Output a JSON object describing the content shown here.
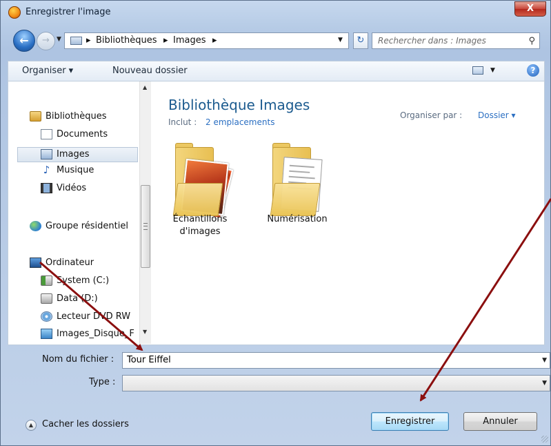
{
  "window": {
    "title": "Enregistrer l'image",
    "close_label": "X"
  },
  "navigation": {
    "breadcrumbs": [
      "Bibliothèques",
      "Images"
    ],
    "search_placeholder": "Rechercher dans : Images"
  },
  "toolbar": {
    "organize_label": "Organiser ▾",
    "new_folder_label": "Nouveau dossier",
    "help_label": "?"
  },
  "nav_pane": {
    "items": [
      {
        "label": "Bibliothèques",
        "icon": "library-icon"
      },
      {
        "label": "Documents",
        "icon": "documents-icon"
      },
      {
        "label": "Images",
        "icon": "pictures-icon",
        "selected": true
      },
      {
        "label": "Musique",
        "icon": "music-icon"
      },
      {
        "label": "Vidéos",
        "icon": "videos-icon"
      },
      {
        "label": "Groupe résidentiel",
        "icon": "homegroup-icon"
      },
      {
        "label": "Ordinateur",
        "icon": "computer-icon"
      },
      {
        "label": "System (C:)",
        "icon": "system-drive-icon"
      },
      {
        "label": "Data (D:)",
        "icon": "drive-icon"
      },
      {
        "label": "Lecteur DVD RW",
        "icon": "dvd-icon"
      },
      {
        "label": "Images_Disque_F",
        "icon": "network-drive-icon"
      }
    ]
  },
  "library": {
    "title": "Bibliothèque Images",
    "includes_label": "Inclut :",
    "includes_link": "2 emplacements",
    "arrange_label": "Organiser par :",
    "arrange_value": "Dossier ▾"
  },
  "folders": [
    {
      "line1": "Échantillons",
      "line2": "d'images"
    },
    {
      "line1": "Numérisation",
      "line2": ""
    }
  ],
  "form": {
    "filename_label": "Nom du fichier :",
    "filename_value": "Tour Eiffel",
    "type_label": "Type :",
    "type_value": ""
  },
  "footer": {
    "hide_folders_label": "Cacher les dossiers",
    "save_label": "Enregistrer",
    "cancel_label": "Annuler"
  },
  "colors": {
    "annotation_arrow": "#8b0f0f",
    "link": "#2b6fc2",
    "title_blue": "#1c5b8f"
  }
}
